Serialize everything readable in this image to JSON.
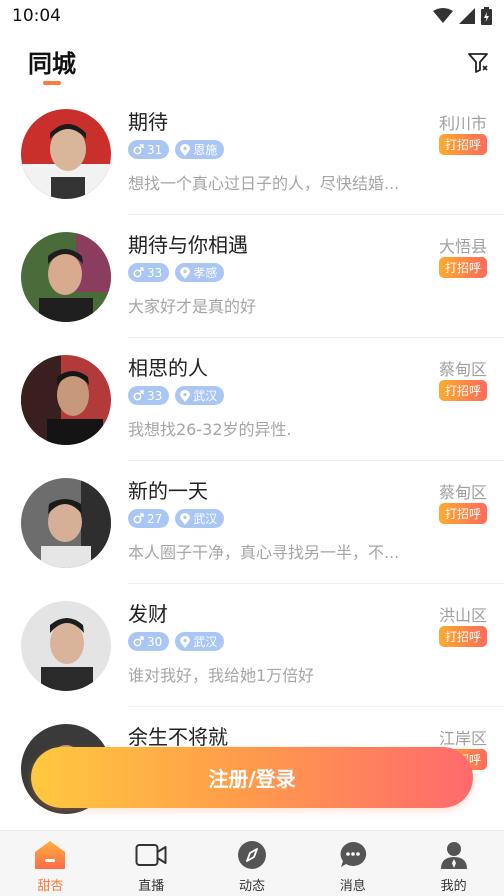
{
  "status": {
    "time": "10:04"
  },
  "header": {
    "title": "同城"
  },
  "users": [
    {
      "name": "期待",
      "age": "31",
      "location": "恩施",
      "bio": "想找一个真心过日子的人，尽快结婚...",
      "city": "利川市",
      "greet": "打招呼"
    },
    {
      "name": "期待与你相遇",
      "age": "33",
      "location": "孝感",
      "bio": "大家好才是真的好",
      "city": "大悟县",
      "greet": "打招呼"
    },
    {
      "name": "相思的人",
      "age": "33",
      "location": "武汉",
      "bio": "我想找26-32岁的异性.",
      "city": "蔡甸区",
      "greet": "打招呼"
    },
    {
      "name": "新的一天",
      "age": "27",
      "location": "武汉",
      "bio": "本人圈子干净，真心寻找另一半，不...",
      "city": "蔡甸区",
      "greet": "打招呼"
    },
    {
      "name": "发财",
      "age": "30",
      "location": "武汉",
      "bio": "谁对我好，我给她1万倍好",
      "city": "洪山区",
      "greet": "打招呼"
    },
    {
      "name": "余生不将就",
      "age": "",
      "location": "",
      "bio": "",
      "city": "江岸区",
      "greet": "打招呼"
    }
  ],
  "login_button": "注册/登录",
  "tabs": [
    {
      "label": "甜杏",
      "icon": "home-icon"
    },
    {
      "label": "直播",
      "icon": "video-camera-icon"
    },
    {
      "label": "动态",
      "icon": "compass-icon"
    },
    {
      "label": "消息",
      "icon": "chat-bubble-icon"
    },
    {
      "label": "我的",
      "icon": "person-icon"
    }
  ],
  "colors": {
    "accent": "#ff7a3d",
    "badge": "#a9c6f5",
    "greet_start": "#ffab2e",
    "greet_end": "#ff6a5a"
  }
}
